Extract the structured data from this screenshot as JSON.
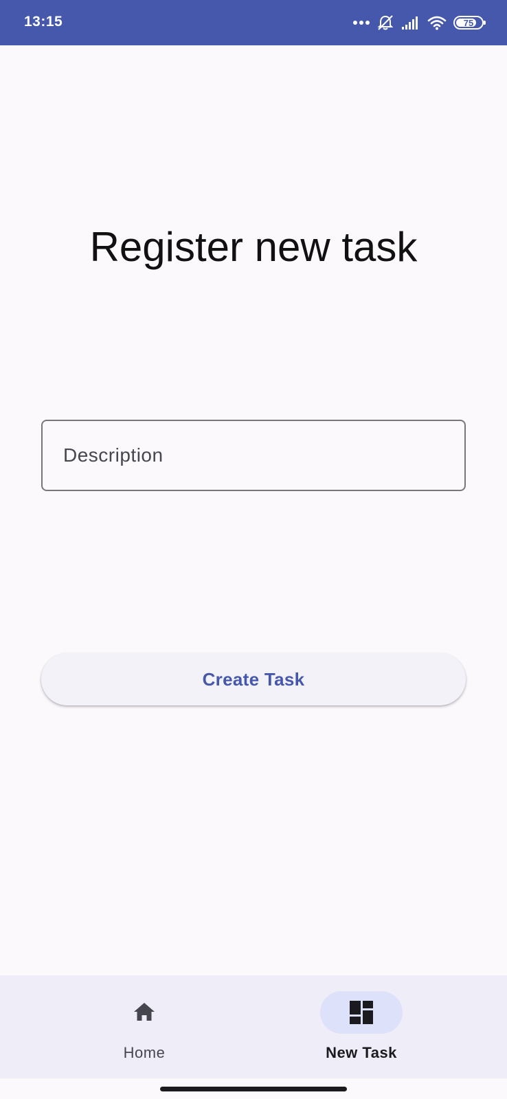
{
  "status_bar": {
    "time": "13:15",
    "battery_level": "75",
    "icons": [
      "more-dots-icon",
      "alarm-off-icon",
      "signal-icon",
      "wifi-icon",
      "battery-icon"
    ],
    "background_color": "#4658ab"
  },
  "main": {
    "title": "Register new task",
    "description_field": {
      "placeholder": "Description",
      "value": ""
    },
    "create_button_label": "Create Task"
  },
  "bottom_nav": {
    "items": [
      {
        "label": "Home",
        "icon": "home-icon",
        "selected": false
      },
      {
        "label": "New Task",
        "icon": "dashboard-icon",
        "selected": true
      }
    ]
  },
  "colors": {
    "accent": "#4658ab",
    "background": "#fcf9fd",
    "nav_background": "#efedf7",
    "nav_indicator": "#dde1f9"
  }
}
